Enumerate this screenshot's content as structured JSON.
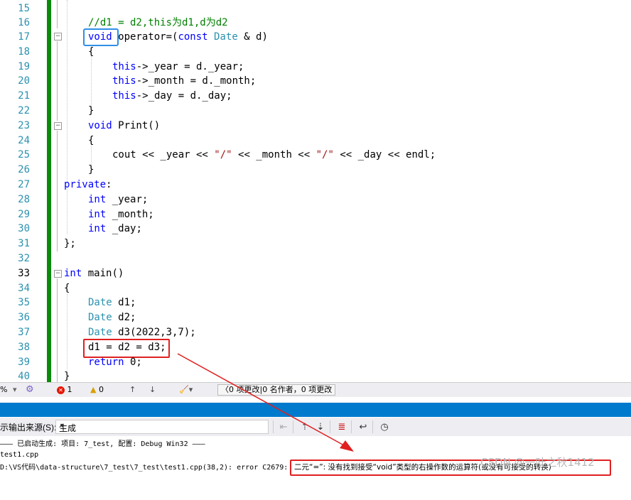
{
  "editor": {
    "line_numbers": [
      "15",
      "16",
      "17",
      "18",
      "19",
      "20",
      "21",
      "22",
      "23",
      "24",
      "25",
      "26",
      "27",
      "28",
      "29",
      "30",
      "31",
      "32",
      "33",
      "34",
      "35",
      "36",
      "37",
      "38",
      "39",
      "40"
    ],
    "current_line": "33",
    "lines": {
      "l15": "",
      "l16_comment": "//d1 = d2,this为d1,d为d2",
      "l17_void": "void",
      "l17_rest_a": " operator=(",
      "l17_const": "const",
      "l17_space": " ",
      "l17_type": "Date",
      "l17_rest_b": " & d)",
      "l18": "{",
      "l19_this": "this",
      "l19_rest": "->_year = d._year;",
      "l20_this": "this",
      "l20_rest": "->_month = d._month;",
      "l21_this": "this",
      "l21_rest": "->_day = d._day;",
      "l22": "}",
      "l23_void": "void",
      "l23_rest": " Print()",
      "l24": "{",
      "l25_a": "cout << _year << ",
      "l25_s1": "\"/\"",
      "l25_b": " << _month << ",
      "l25_s2": "\"/\"",
      "l25_c": " << _day << endl;",
      "l26": "}",
      "l27_kw": "private",
      "l27_rest": ":",
      "l28_kw": "int",
      "l28_rest": " _year;",
      "l29_kw": "int",
      "l29_rest": " _month;",
      "l30_kw": "int",
      "l30_rest": " _day;",
      "l31": "};",
      "l33_kw": "int",
      "l33_rest": " main()",
      "l34": "{",
      "l35_type": "Date",
      "l35_rest": " d1;",
      "l36_type": "Date",
      "l36_rest": " d2;",
      "l37_type": "Date",
      "l37_rest": " d3(2022,3,7);",
      "l38": "d1 = d2 = d3;",
      "l39_kw": "return",
      "l39_rest": " 0;",
      "l40": "}"
    }
  },
  "statusbar": {
    "zoom": "%",
    "errors": "1",
    "warnings": "0",
    "changes": "0 项更改|0 名作者，0 项更改"
  },
  "output_panel": {
    "source_label": "示输出来源(S):",
    "source_value": "生成",
    "lines": [
      "——— 已启动生成: 项目: 7_test, 配置: Debug Win32 ———",
      "test1.cpp",
      "D:\\VS代码\\data-structure\\7_test\\7_test\\test1.cpp(38,2): error C2679: "
    ],
    "error_message": "二元“=”: 没有找到接受“void”类型的右操作数的运算符(或没有可接受的转换)"
  },
  "watermark": "CSDN @一叶之秋1412",
  "colors": {
    "keyword": "#0000ff",
    "type": "#2b91af",
    "comment": "#008000",
    "string": "#a31515",
    "highlight_box_blue": "#2f8fe8",
    "highlight_box_red": "#e02020",
    "change_bar": "#0a8a0a",
    "panel_title": "#007acc"
  }
}
